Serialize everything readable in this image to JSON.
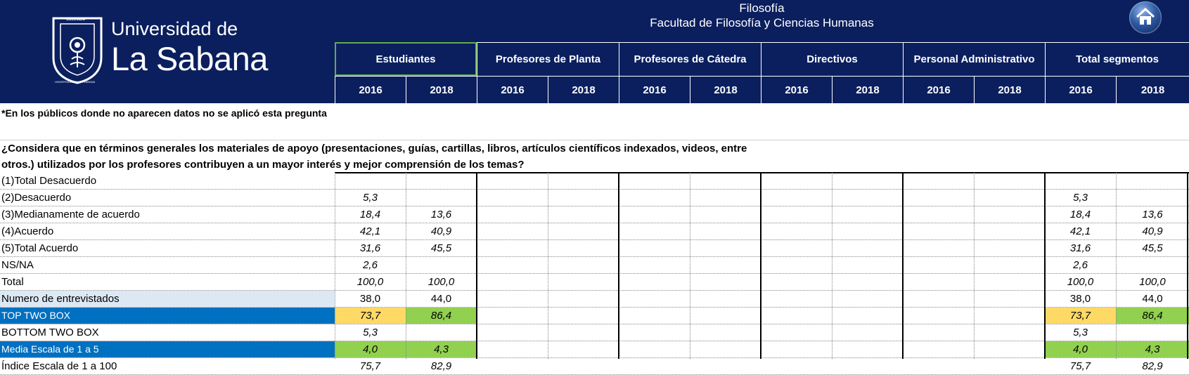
{
  "header": {
    "logo_top": "COLOMBIA",
    "logo_ring": "UNIVERSIDAD DE LA SABANA",
    "logo_line1": "Universidad de",
    "logo_line2": "La Sabana",
    "program": "Filosofía",
    "faculty": "Facultad de Filosofía y Ciencias Humanas",
    "home_icon": "home-icon",
    "segments": [
      "Estudiantes",
      "Profesores de Planta",
      "Profesores de Cátedra",
      "Directivos",
      "Personal Administrativo",
      "Total segmentos"
    ],
    "years": [
      "2016",
      "2018",
      "2016",
      "2018",
      "2016",
      "2018",
      "2016",
      "2018",
      "2016",
      "2018",
      "2016",
      "2018"
    ]
  },
  "colors": {
    "header_bg": "#0b1f5e",
    "blue_label": "#0070c0",
    "light_label": "#dce9f5",
    "yellow": "#ffd966",
    "green": "#92d050",
    "selection": "#5fae4a"
  },
  "note": "*En los públicos donde no aparecen datos no se aplicó esta pregunta",
  "question_line1": "¿Considera que en términos generales los materiales de apoyo (presentaciones, guías, cartillas, libros, artículos científicos indexados, videos, entre",
  "question_line2": "otros.) utilizados por los profesores contribuyen a un mayor interés y mejor comprensión de los temas?",
  "table": {
    "rows": [
      {
        "label": "(1)Total Desacuerdo",
        "est16": "",
        "est18": "",
        "tot16": "",
        "tot18": ""
      },
      {
        "label": "(2)Desacuerdo",
        "est16": "5,3",
        "est18": "",
        "tot16": "5,3",
        "tot18": ""
      },
      {
        "label": "(3)Medianamente de acuerdo",
        "est16": "18,4",
        "est18": "13,6",
        "tot16": "18,4",
        "tot18": "13,6"
      },
      {
        "label": "(4)Acuerdo",
        "est16": "42,1",
        "est18": "40,9",
        "tot16": "42,1",
        "tot18": "40,9"
      },
      {
        "label": "(5)Total Acuerdo",
        "est16": "31,6",
        "est18": "45,5",
        "tot16": "31,6",
        "tot18": "45,5"
      },
      {
        "label": "NS/NA",
        "est16": "2,6",
        "est18": "",
        "tot16": "2,6",
        "tot18": ""
      },
      {
        "label": "Total",
        "est16": "100,0",
        "est18": "100,0",
        "tot16": "100,0",
        "tot18": "100,0"
      },
      {
        "label": "Numero de entrevistados",
        "est16": "38,0",
        "est18": "44,0",
        "tot16": "38,0",
        "tot18": "44,0"
      },
      {
        "label": "TOP TWO BOX",
        "est16": "73,7",
        "est18": "86,4",
        "tot16": "73,7",
        "tot18": "86,4"
      },
      {
        "label": "BOTTOM TWO BOX",
        "est16": "5,3",
        "est18": "",
        "tot16": "5,3",
        "tot18": ""
      },
      {
        "label": "Media Escala de 1 a 5",
        "est16": "4,0",
        "est18": "4,3",
        "tot16": "4,0",
        "tot18": "4,3"
      },
      {
        "label": "Índice Escala de 1 a 100",
        "est16": "75,7",
        "est18": "82,9",
        "tot16": "75,7",
        "tot18": "82,9"
      }
    ]
  }
}
